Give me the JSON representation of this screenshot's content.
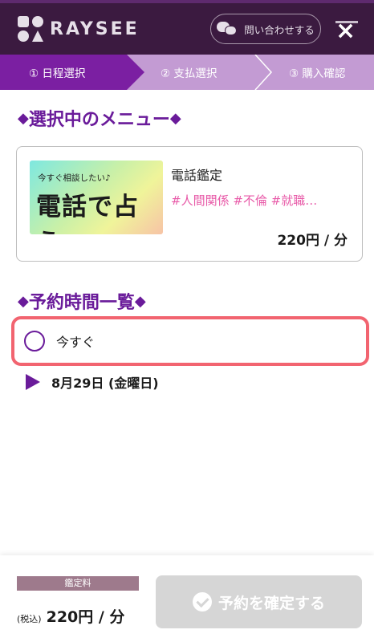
{
  "header": {
    "logo_text": "RAYSEE",
    "contact_label": "問い合わせする",
    "close_icon": "×"
  },
  "steps": [
    {
      "label": "① 日程選択",
      "active": true
    },
    {
      "label": "② 支払選択",
      "active": false
    },
    {
      "label": "③ 購入確認",
      "active": false
    }
  ],
  "selected_menu": {
    "title": "選択中のメニュー",
    "thumb_small": "今すぐ相談したい♪",
    "thumb_big": "電話で占う",
    "name": "電話鑑定",
    "tags": "#人間関係 #不倫 #就職…",
    "price": "220円 / 分"
  },
  "schedule": {
    "title": "予約時間一覧",
    "now_label": "今すぐ",
    "date_label": "8月29日 (金曜日)"
  },
  "footer": {
    "fee_label": "鑑定料",
    "tax_label": "(税込)",
    "price": "220円 / 分",
    "confirm_label": "予約を確定する"
  },
  "colors": {
    "header_bg": "#3b1a40",
    "accent_purple": "#6a1b9a",
    "step_active": "#7b1fa2",
    "step_inactive": "#c39bd3",
    "tag_pink": "#e85aa8",
    "highlight_red": "#f26470"
  }
}
